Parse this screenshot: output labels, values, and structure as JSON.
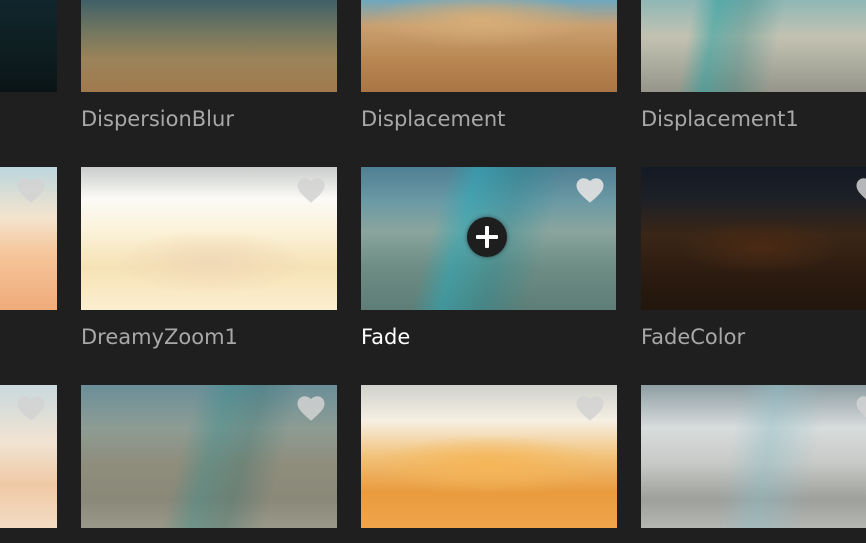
{
  "transitions": {
    "row1": [
      {
        "label": "DispersionBlur"
      },
      {
        "label": "Displacement"
      },
      {
        "label": "Displacement1"
      }
    ],
    "row2": [
      {
        "label": "DreamyZoom1"
      },
      {
        "label": "Fade",
        "selected": true
      },
      {
        "label": "FadeColor"
      }
    ]
  },
  "icons": {
    "favorite": "heart-icon",
    "add": "plus-icon"
  },
  "colors": {
    "background": "#1f1f1f",
    "label": "#a8a8a8",
    "label_active": "#ffffff",
    "selection_border": "#e6e6e6"
  }
}
